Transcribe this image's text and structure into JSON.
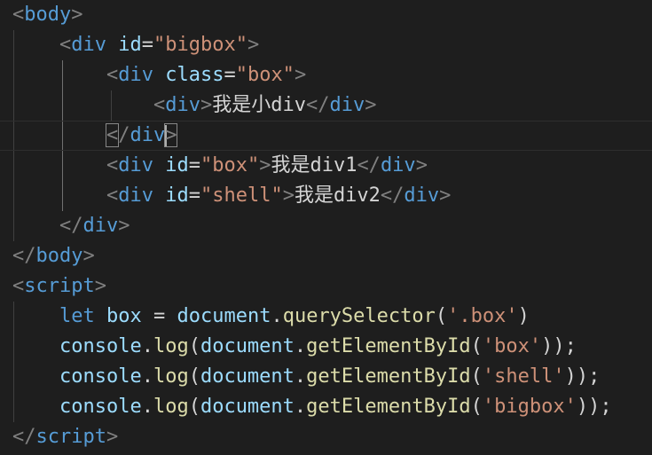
{
  "editor": {
    "theme": "dark",
    "colors": {
      "background": "#1e1e1e",
      "punctuation": "#808080",
      "tag": "#569cd6",
      "attribute": "#9cdcfe",
      "string": "#ce9178",
      "function": "#dcdcaa",
      "text": "#d4d4d4"
    },
    "lines": [
      [
        {
          "t": "punc",
          "v": "<"
        },
        {
          "t": "tag",
          "v": "body"
        },
        {
          "t": "punc",
          "v": ">"
        }
      ],
      [
        {
          "t": "plain",
          "v": "    "
        },
        {
          "t": "punc",
          "v": "<"
        },
        {
          "t": "tag",
          "v": "div"
        },
        {
          "t": "plain",
          "v": " "
        },
        {
          "t": "attr",
          "v": "id"
        },
        {
          "t": "eq",
          "v": "="
        },
        {
          "t": "str",
          "v": "\"bigbox\""
        },
        {
          "t": "punc",
          "v": ">"
        }
      ],
      [
        {
          "t": "plain",
          "v": "        "
        },
        {
          "t": "punc",
          "v": "<"
        },
        {
          "t": "tag",
          "v": "div"
        },
        {
          "t": "plain",
          "v": " "
        },
        {
          "t": "attr",
          "v": "class"
        },
        {
          "t": "eq",
          "v": "="
        },
        {
          "t": "str",
          "v": "\"box\""
        },
        {
          "t": "punc",
          "v": ">"
        }
      ],
      [
        {
          "t": "plain",
          "v": "            "
        },
        {
          "t": "punc",
          "v": "<"
        },
        {
          "t": "tag",
          "v": "div"
        },
        {
          "t": "punc",
          "v": ">"
        },
        {
          "t": "text",
          "v": "我是小div"
        },
        {
          "t": "punc",
          "v": "</"
        },
        {
          "t": "tag",
          "v": "div"
        },
        {
          "t": "punc",
          "v": ">"
        }
      ],
      [
        {
          "t": "plain",
          "v": "        "
        },
        {
          "t": "punc",
          "v": "<",
          "match": true
        },
        {
          "t": "punc",
          "v": "/"
        },
        {
          "t": "tag",
          "v": "div"
        },
        {
          "t": "punc",
          "v": ">",
          "match": true,
          "cursor": true
        }
      ],
      [
        {
          "t": "plain",
          "v": "        "
        },
        {
          "t": "punc",
          "v": "<"
        },
        {
          "t": "tag",
          "v": "div"
        },
        {
          "t": "plain",
          "v": " "
        },
        {
          "t": "attr",
          "v": "id"
        },
        {
          "t": "eq",
          "v": "="
        },
        {
          "t": "str",
          "v": "\"box\""
        },
        {
          "t": "punc",
          "v": ">"
        },
        {
          "t": "text",
          "v": "我是div1"
        },
        {
          "t": "punc",
          "v": "</"
        },
        {
          "t": "tag",
          "v": "div"
        },
        {
          "t": "punc",
          "v": ">"
        }
      ],
      [
        {
          "t": "plain",
          "v": "        "
        },
        {
          "t": "punc",
          "v": "<"
        },
        {
          "t": "tag",
          "v": "div"
        },
        {
          "t": "plain",
          "v": " "
        },
        {
          "t": "attr",
          "v": "id"
        },
        {
          "t": "eq",
          "v": "="
        },
        {
          "t": "str",
          "v": "\"shell\""
        },
        {
          "t": "punc",
          "v": ">"
        },
        {
          "t": "text",
          "v": "我是div2"
        },
        {
          "t": "punc",
          "v": "</"
        },
        {
          "t": "tag",
          "v": "div"
        },
        {
          "t": "punc",
          "v": ">"
        }
      ],
      [
        {
          "t": "plain",
          "v": "    "
        },
        {
          "t": "punc",
          "v": "</"
        },
        {
          "t": "tag",
          "v": "div"
        },
        {
          "t": "punc",
          "v": ">"
        }
      ],
      [
        {
          "t": "punc",
          "v": "</"
        },
        {
          "t": "tag",
          "v": "body"
        },
        {
          "t": "punc",
          "v": ">"
        }
      ],
      [
        {
          "t": "punc",
          "v": "<"
        },
        {
          "t": "tag",
          "v": "script"
        },
        {
          "t": "punc",
          "v": ">"
        }
      ],
      [
        {
          "t": "plain",
          "v": "    "
        },
        {
          "t": "kw",
          "v": "let"
        },
        {
          "t": "plain",
          "v": " "
        },
        {
          "t": "var",
          "v": "box"
        },
        {
          "t": "plain",
          "v": " = "
        },
        {
          "t": "var",
          "v": "document"
        },
        {
          "t": "plain",
          "v": "."
        },
        {
          "t": "fn",
          "v": "querySelector"
        },
        {
          "t": "plain",
          "v": "("
        },
        {
          "t": "str",
          "v": "'.box'"
        },
        {
          "t": "plain",
          "v": ")"
        }
      ],
      [
        {
          "t": "plain",
          "v": "    "
        },
        {
          "t": "var",
          "v": "console"
        },
        {
          "t": "plain",
          "v": "."
        },
        {
          "t": "fn",
          "v": "log"
        },
        {
          "t": "plain",
          "v": "("
        },
        {
          "t": "var",
          "v": "document"
        },
        {
          "t": "plain",
          "v": "."
        },
        {
          "t": "fn",
          "v": "getElementById"
        },
        {
          "t": "plain",
          "v": "("
        },
        {
          "t": "str",
          "v": "'box'"
        },
        {
          "t": "plain",
          "v": "));"
        }
      ],
      [
        {
          "t": "plain",
          "v": "    "
        },
        {
          "t": "var",
          "v": "console"
        },
        {
          "t": "plain",
          "v": "."
        },
        {
          "t": "fn",
          "v": "log"
        },
        {
          "t": "plain",
          "v": "("
        },
        {
          "t": "var",
          "v": "document"
        },
        {
          "t": "plain",
          "v": "."
        },
        {
          "t": "fn",
          "v": "getElementById"
        },
        {
          "t": "plain",
          "v": "("
        },
        {
          "t": "str",
          "v": "'shell'"
        },
        {
          "t": "plain",
          "v": "));"
        }
      ],
      [
        {
          "t": "plain",
          "v": "    "
        },
        {
          "t": "var",
          "v": "console"
        },
        {
          "t": "plain",
          "v": "."
        },
        {
          "t": "fn",
          "v": "log"
        },
        {
          "t": "plain",
          "v": "("
        },
        {
          "t": "var",
          "v": "document"
        },
        {
          "t": "plain",
          "v": "."
        },
        {
          "t": "fn",
          "v": "getElementById"
        },
        {
          "t": "plain",
          "v": "("
        },
        {
          "t": "str",
          "v": "'bigbox'"
        },
        {
          "t": "plain",
          "v": "));"
        }
      ],
      [
        {
          "t": "punc",
          "v": "</"
        },
        {
          "t": "tag",
          "v": "script"
        },
        {
          "t": "punc",
          "v": ">"
        }
      ]
    ]
  }
}
